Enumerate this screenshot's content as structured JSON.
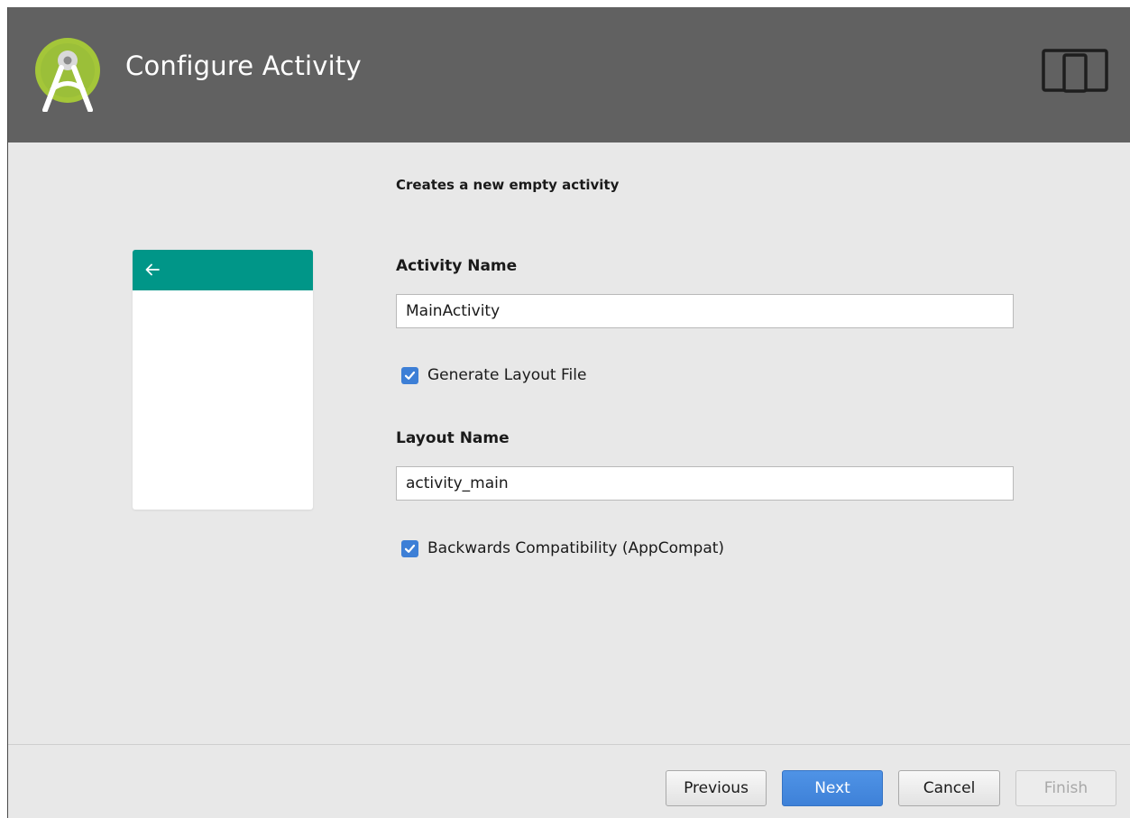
{
  "header": {
    "title": "Configure Activity",
    "logo_icon": "android-studio-logo",
    "form_factor_icon": "phone-and-tablet-icon"
  },
  "main": {
    "description": "Creates a new empty activity",
    "preview": {
      "toolbar_color": "#009688",
      "back_icon": "arrow-back-icon"
    },
    "activity_name": {
      "label": "Activity Name",
      "value": "MainActivity"
    },
    "generate_layout": {
      "label": "Generate Layout File",
      "checked": true
    },
    "layout_name": {
      "label": "Layout Name",
      "value": "activity_main"
    },
    "backwards_compat": {
      "label": "Backwards Compatibility (AppCompat)",
      "checked": true
    }
  },
  "footer": {
    "previous_label": "Previous",
    "next_label": "Next",
    "cancel_label": "Cancel",
    "finish_label": "Finish"
  },
  "colors": {
    "header_bg": "#616161",
    "body_bg": "#e8e8e8",
    "accent_blue": "#3d7fd6",
    "android_green": "#a4c639"
  }
}
